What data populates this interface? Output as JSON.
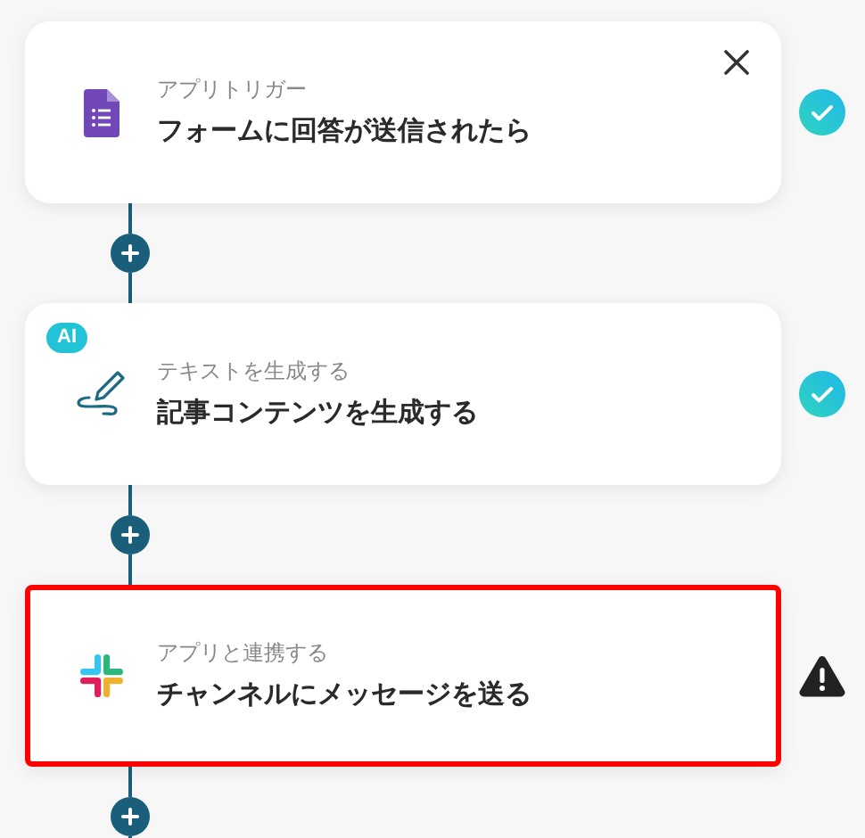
{
  "steps": [
    {
      "kind": "form",
      "label": "アプリトリガー",
      "title": "フォームに回答が送信されたら",
      "closable": true,
      "status": {
        "kind": "done"
      },
      "selected": false
    },
    {
      "kind": "ai_write",
      "label": "テキストを生成する",
      "title": "記事コンテンツを生成する",
      "badge": "AI",
      "closable": false,
      "status": {
        "kind": "done"
      },
      "selected": false
    },
    {
      "kind": "slack",
      "label": "アプリと連携する",
      "title": "チャンネルにメッセージを送る",
      "closable": false,
      "status": {
        "kind": "warning"
      },
      "selected": true
    }
  ]
}
